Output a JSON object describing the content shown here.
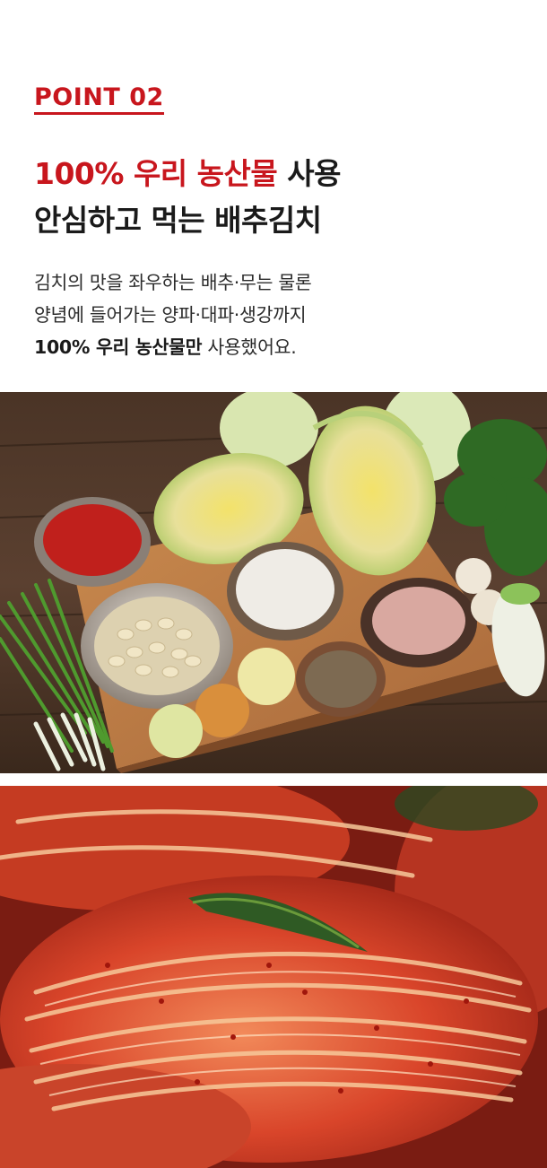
{
  "point": {
    "label": "POINT 02"
  },
  "headline": {
    "line1_accent": "100% 우리 농산물",
    "line1_rest": " 사용",
    "line2": "안심하고 먹는 배추김치"
  },
  "description": {
    "line1": "김치의 맛을 좌우하는 배추·무는 물론",
    "line2": "양념에 들어가는 양파·대파·생강까지",
    "line3_bold": "100% 우리 농산물만",
    "line3_rest": " 사용했어요."
  },
  "images": {
    "ingredients_icon": "ingredients-photo",
    "kimchi_icon": "kimchi-photo"
  },
  "colors": {
    "accent": "#c8161d",
    "text": "#1a1a1a",
    "background": "#ffffff"
  }
}
